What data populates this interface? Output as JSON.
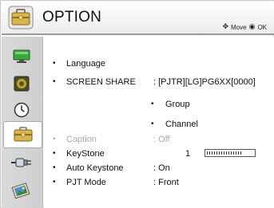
{
  "header": {
    "title": "OPTION",
    "hint_move": "Move",
    "hint_ok": "OK"
  },
  "sidebar": {
    "items": [
      {
        "icon": "monitor-icon"
      },
      {
        "icon": "speaker-icon"
      },
      {
        "icon": "clock-icon"
      },
      {
        "icon": "toolbox-icon",
        "selected": true
      },
      {
        "icon": "plug-icon"
      },
      {
        "icon": "photo-icon"
      }
    ]
  },
  "menu": {
    "language": {
      "label": "Language"
    },
    "screen_share": {
      "label": "SCREEN SHARE",
      "value": ": [PJTR][LG]PG6XX[0000]"
    },
    "group": {
      "label": "Group"
    },
    "channel": {
      "label": "Channel"
    },
    "caption": {
      "label": "Caption",
      "value": ": Off"
    },
    "keystone": {
      "label": "KeyStone",
      "value": "1",
      "level": 0.75
    },
    "auto_keystone": {
      "label": "Auto Keystone",
      "value": ": On"
    },
    "pjt_mode": {
      "label": "PJT Mode",
      "value": ": Front"
    }
  },
  "colors": {
    "disabled_text": "#a9a9a9",
    "header_rule": "#9a9a9a"
  }
}
